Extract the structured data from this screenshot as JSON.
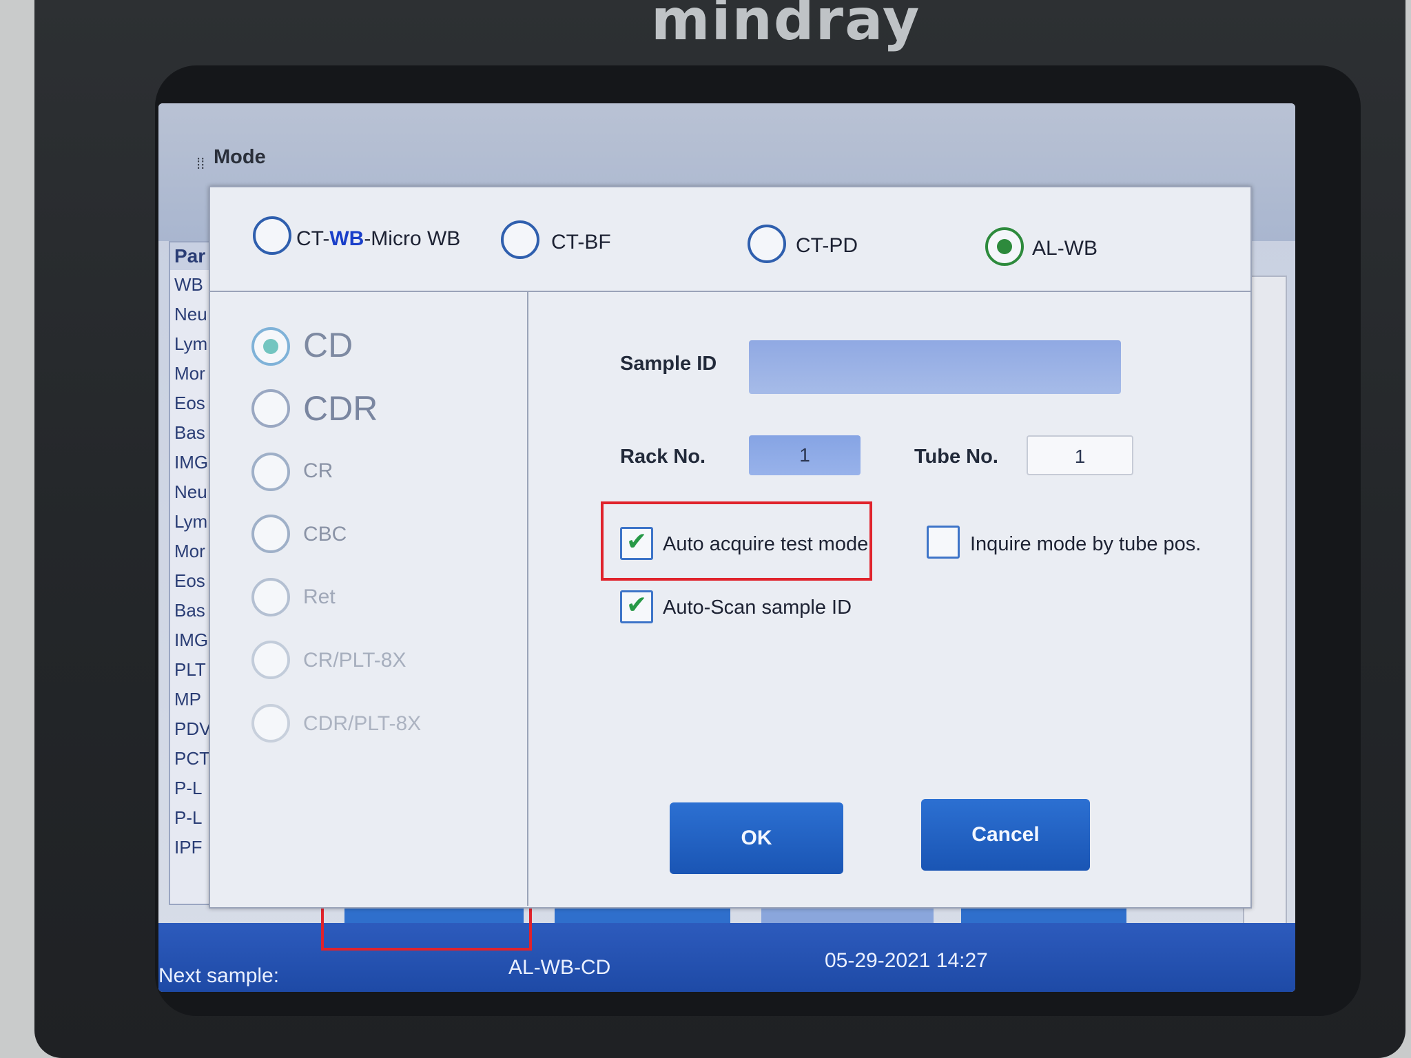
{
  "device": {
    "brand": "mindray"
  },
  "window": {
    "title": "Mode"
  },
  "param_list": {
    "header": "Par",
    "rows": [
      "WB",
      "Neu",
      "Lym",
      "Mor",
      "Eos",
      "Bas",
      "IMG",
      "Neu",
      "Lym",
      "Mor",
      "Eos",
      "Bas",
      "IMG",
      "PLT",
      "MP",
      "PDV",
      "PCT",
      "P-L",
      "P-L",
      "IPF"
    ]
  },
  "modes": [
    {
      "label_prefix": "CT-",
      "label_wb": "WB",
      "label_suffix": "-Micro WB",
      "selected": false
    },
    {
      "label": "CT-BF",
      "selected": false
    },
    {
      "label": "CT-PD",
      "selected": false
    },
    {
      "label": "AL-WB",
      "selected": true
    }
  ],
  "tests": [
    {
      "label": "CD",
      "selected": true
    },
    {
      "label": "CDR",
      "selected": false
    },
    {
      "label": "CR",
      "selected": false
    },
    {
      "label": "CBC",
      "selected": false
    },
    {
      "label": "Ret",
      "selected": false
    },
    {
      "label": "CR/PLT-8X",
      "selected": false
    },
    {
      "label": "CDR/PLT-8X",
      "selected": false
    }
  ],
  "fields": {
    "sample_id_label": "Sample ID",
    "sample_id_value": "",
    "rack_label": "Rack No.",
    "rack_value": "1",
    "tube_label": "Tube No.",
    "tube_value": "1"
  },
  "options": {
    "auto_acquire_label": "Auto acquire test mode",
    "auto_acquire_checked": true,
    "inquire_mode_label": "Inquire mode by tube pos.",
    "inquire_mode_checked": false,
    "auto_scan_label": "Auto-Scan sample ID",
    "auto_scan_checked": true
  },
  "buttons": {
    "ok": "OK",
    "cancel": "Cancel"
  },
  "status": {
    "next_sample_label": "Next sample:",
    "current_mode": "AL-WB-CD",
    "datetime": "05-29-2021 14:27"
  },
  "colors": {
    "accent": "#1a55b4",
    "selected_radio": "#2d8a3c",
    "highlight": "#e0232c"
  }
}
